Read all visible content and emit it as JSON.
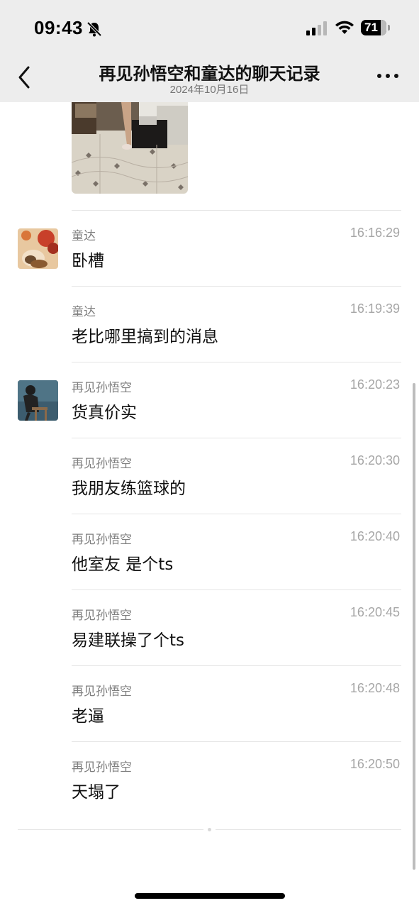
{
  "status_bar": {
    "time": "09:43",
    "battery": "71",
    "icons": [
      "bell-slash-icon",
      "signal-icon",
      "wifi-icon",
      "battery-icon"
    ]
  },
  "nav": {
    "title": "再见孙悟空和童达的聊天记录",
    "subtitle": "2024年10月16日",
    "icons": [
      "back-chevron-icon",
      "more-dots-icon"
    ]
  },
  "messages": [
    {
      "sender": "童达",
      "time": "16:16:29",
      "text": "卧槽",
      "avatar": "tongda"
    },
    {
      "sender": "童达",
      "time": "16:19:39",
      "text": "老比哪里搞到的消息",
      "avatar": null
    },
    {
      "sender": "再见孙悟空",
      "time": "16:20:23",
      "text": "货真价实",
      "avatar": "wukong"
    },
    {
      "sender": "再见孙悟空",
      "time": "16:20:30",
      "text": "我朋友练篮球的",
      "avatar": null
    },
    {
      "sender": "再见孙悟空",
      "time": "16:20:40",
      "text": "他室友 是个ts",
      "avatar": null
    },
    {
      "sender": "再见孙悟空",
      "time": "16:20:45",
      "text": "易建联操了个ts",
      "avatar": null
    },
    {
      "sender": "再见孙悟空",
      "time": "16:20:48",
      "text": "老逼",
      "avatar": null
    },
    {
      "sender": "再见孙悟空",
      "time": "16:20:50",
      "text": "天塌了",
      "avatar": null
    }
  ],
  "colors": {
    "header_bg": "#ededed",
    "meta_text": "#7f7f7f",
    "timestamp": "#a6a6a6",
    "divider": "#e5e5e5"
  }
}
